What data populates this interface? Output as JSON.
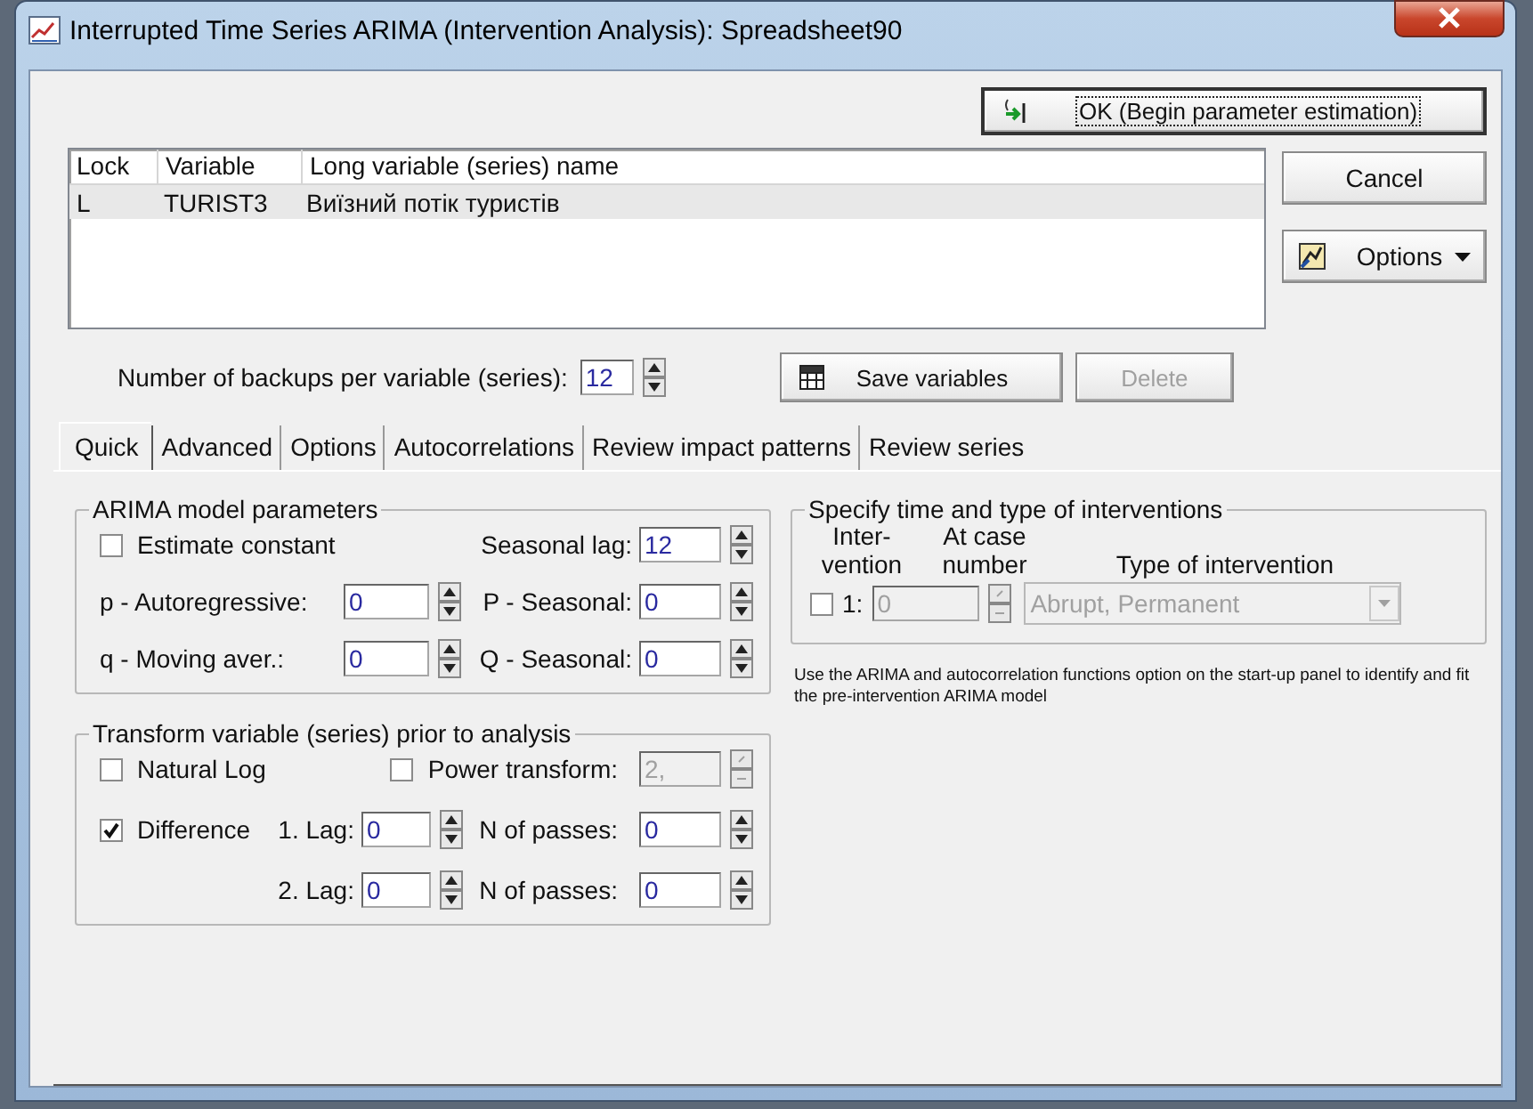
{
  "window": {
    "title": "Interrupted Time Series ARIMA (Intervention Analysis): Spreadsheet90"
  },
  "ok_button": {
    "label": "OK (Begin parameter estimation)"
  },
  "cancel_button": {
    "label": "Cancel"
  },
  "options_button": {
    "label": "Options"
  },
  "variables": {
    "columns": [
      "Lock",
      "Variable",
      "Long variable (series) name"
    ],
    "rows": [
      {
        "cells": [
          "L",
          "TURIST3",
          "Виїзний потік туристів"
        ],
        "selected": true
      }
    ]
  },
  "backups": {
    "label": "Number of backups per variable (series):",
    "value": "12"
  },
  "save_button": {
    "label": "Save variables",
    "disabled": false
  },
  "delete_button": {
    "label": "Delete",
    "disabled": true
  },
  "tabs": [
    {
      "label": "Quick",
      "selected": true
    },
    {
      "label": "Advanced",
      "selected": false
    },
    {
      "label": "Options",
      "selected": false
    },
    {
      "label": "Autocorrelations",
      "selected": false
    },
    {
      "label": "Review impact patterns",
      "selected": false
    },
    {
      "label": "Review series",
      "selected": false
    }
  ],
  "arima_group": {
    "title": "ARIMA model parameters",
    "items": [
      {
        "kind": "checkbox",
        "label": "Estimate constant",
        "checked": false
      },
      {
        "kind": "spin",
        "label": "Seasonal lag:",
        "value": "12",
        "disabled": false
      },
      {
        "kind": "spin",
        "label": "p - Autoregressive:",
        "value": "0",
        "disabled": false
      },
      {
        "kind": "spin",
        "label": "P - Seasonal:",
        "value": "0",
        "disabled": false
      },
      {
        "kind": "spin",
        "label": "q - Moving aver.:",
        "value": "0",
        "disabled": false
      },
      {
        "kind": "spin",
        "label": "Q - Seasonal:",
        "value": "0",
        "disabled": false
      }
    ]
  },
  "transform_group": {
    "title": "Transform variable (series) prior to analysis",
    "items": [
      {
        "kind": "checkbox",
        "label": "Natural Log",
        "checked": false
      },
      {
        "kind": "checkbox",
        "label": "Power transform:",
        "checked": false
      },
      {
        "kind": "spin",
        "value": "2,",
        "disabled": true
      },
      {
        "kind": "checkbox",
        "label": "Difference",
        "checked": true
      },
      {
        "kind": "spin",
        "label": "1. Lag:",
        "value": "0",
        "disabled": false
      },
      {
        "kind": "spin",
        "label": "N of passes:",
        "value": "0",
        "disabled": false
      },
      {
        "kind": "blank"
      },
      {
        "kind": "spin",
        "label": "2. Lag:",
        "value": "0",
        "disabled": false
      },
      {
        "kind": "spin",
        "label": "N of passes:",
        "value": "0",
        "disabled": false
      }
    ]
  },
  "interventions_group": {
    "title": "Specify time and type of interventions",
    "columns": [
      "Inter-\nvention",
      "At case\nnumber",
      "Type of intervention"
    ],
    "rows": [
      {
        "checked": false,
        "number": "1:",
        "case": "0",
        "type": "Abrupt, Permanent",
        "disabled": true
      }
    ]
  },
  "note": "Use the ARIMA and autocorrelation functions option on the start-up panel to identify and fit the pre-intervention ARIMA model"
}
